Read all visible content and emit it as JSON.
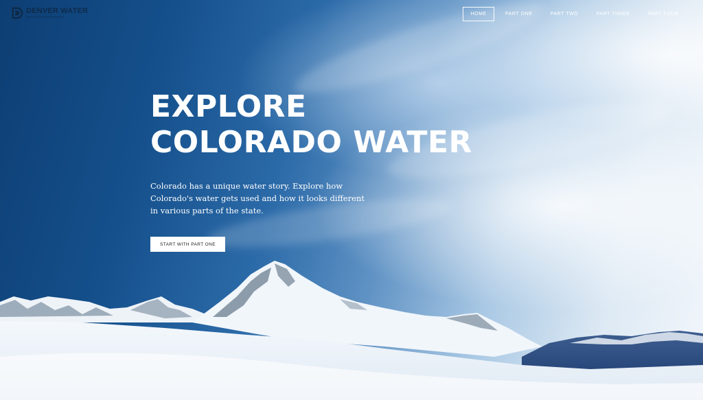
{
  "brand": {
    "name": "DENVER WATER",
    "tagline": "EDUCATION RESOURCES",
    "color": "#0e2a4a",
    "icon": "denver-water-logo-icon"
  },
  "nav": {
    "items": [
      {
        "label": "HOME",
        "active": true
      },
      {
        "label": "PART ONE",
        "active": false
      },
      {
        "label": "PART TWO",
        "active": false
      },
      {
        "label": "PART THREE",
        "active": false
      },
      {
        "label": "PART FOUR",
        "active": false
      }
    ]
  },
  "hero": {
    "title_line1": "EXPLORE",
    "title_line2": "COLORADO WATER",
    "description": "Colorado has a unique water story. Explore how Colorado's water gets used and how it looks different in various parts of the state.",
    "cta_label": "START WITH PART ONE",
    "background_image": "snowy-mountain-peaks-under-blue-sky"
  },
  "colors": {
    "sky_dark": "#0d3e73",
    "sky_light": "#f3f7fb",
    "text": "#ffffff"
  }
}
